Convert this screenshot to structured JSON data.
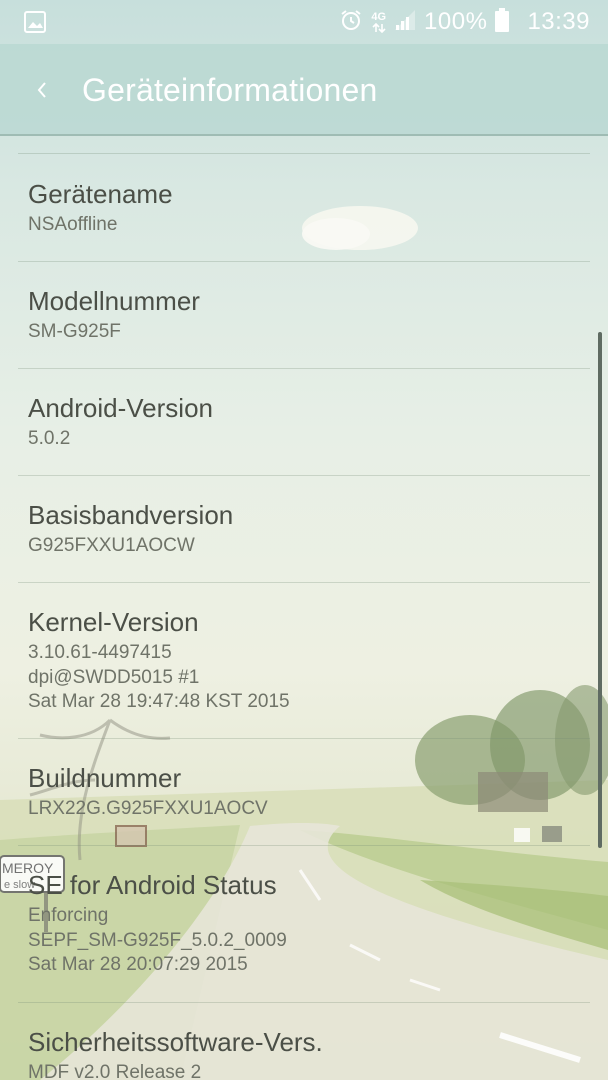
{
  "status_bar": {
    "icons": [
      "gallery-icon",
      "alarm-icon",
      "4g-icon",
      "signal-icon",
      "battery-icon"
    ],
    "network_label": "4G",
    "battery": "100%",
    "time": "13:39"
  },
  "app_bar": {
    "back_icon": "chevron-left-icon",
    "title": "Geräteinformationen"
  },
  "items": [
    {
      "title": "Gerätename",
      "value": "NSAoffline"
    },
    {
      "title": "Modellnummer",
      "value": "SM-G925F"
    },
    {
      "title": "Android-Version",
      "value": "5.0.2"
    },
    {
      "title": "Basisbandversion",
      "value": "G925FXXU1AOCW"
    },
    {
      "title": "Kernel-Version",
      "value": "3.10.61-4497415\ndpi@SWDD5015 #1\nSat Mar 28 19:47:48 KST 2015"
    },
    {
      "title": "Buildnummer",
      "value": "LRX22G.G925FXXU1AOCV"
    },
    {
      "title": "SE for Android Status",
      "value": "Enforcing\nSEPF_SM-G925F_5.0.2_0009\nSat Mar 28 20:07:29 2015"
    },
    {
      "title": "Sicherheitssoftware-Vers.",
      "value": "MDF v2.0 Release 2"
    }
  ],
  "wallpaper": {
    "sign_text": "MEROY",
    "sign_subtext": "e slow"
  },
  "colors": {
    "app_bar": "#bad8d2",
    "title_text": "#4b4f47",
    "value_text": "#6f7368"
  }
}
